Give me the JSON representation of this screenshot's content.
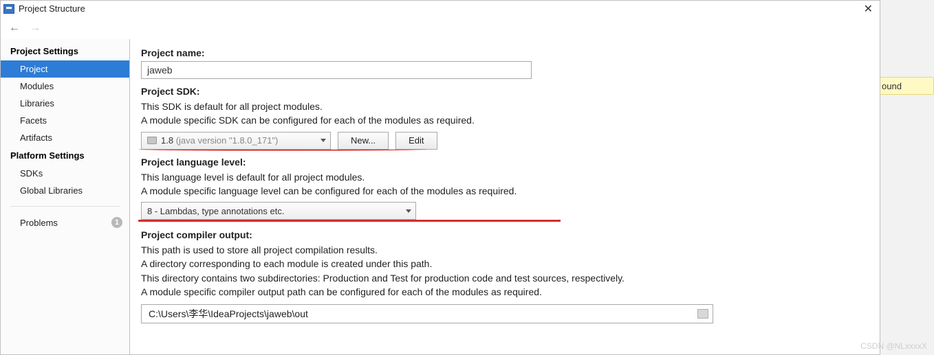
{
  "window": {
    "title": "Project Structure",
    "close_glyph": "✕"
  },
  "nav": {
    "back_glyph": "←",
    "forward_glyph": "→"
  },
  "sidebar": {
    "project_settings_heading": "Project Settings",
    "project_items": {
      "project": "Project",
      "modules": "Modules",
      "libraries": "Libraries",
      "facets": "Facets",
      "artifacts": "Artifacts"
    },
    "platform_settings_heading": "Platform Settings",
    "platform_items": {
      "sdks": "SDKs",
      "global_libs": "Global Libraries"
    },
    "problems_label": "Problems",
    "problems_count": "1"
  },
  "form": {
    "name_label": "Project name:",
    "name_value": "jaweb",
    "sdk_label": "Project SDK:",
    "sdk_desc1": "This SDK is default for all project modules.",
    "sdk_desc2": "A module specific SDK can be configured for each of the modules as required.",
    "sdk_value_lead": "1.8",
    "sdk_value_tail": " (java version \"1.8.0_171\")",
    "new_button": "New...",
    "edit_button": "Edit",
    "lang_label": "Project language level:",
    "lang_desc1": "This language level is default for all project modules.",
    "lang_desc2": "A module specific language level can be configured for each of the modules as required.",
    "lang_value": "8 - Lambdas, type annotations etc.",
    "out_label": "Project compiler output:",
    "out_desc1": "This path is used to store all project compilation results.",
    "out_desc2": "A directory corresponding to each module is created under this path.",
    "out_desc3": "This directory contains two subdirectories: Production and Test for production code and test sources, respectively.",
    "out_desc4": "A module specific compiler output path can be configured for each of the modules as required.",
    "out_value": "C:\\Users\\李华\\IdeaProjects\\jaweb\\out"
  },
  "background": {
    "stripe_tail": "ound"
  },
  "watermark": "CSDN @NLxxxxX"
}
